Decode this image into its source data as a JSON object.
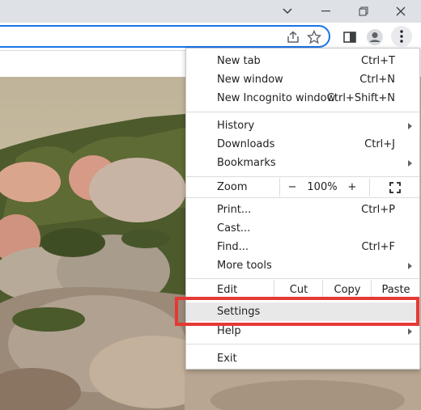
{
  "menu": {
    "new_tab": {
      "label": "New tab",
      "shortcut": "Ctrl+T"
    },
    "new_window": {
      "label": "New window",
      "shortcut": "Ctrl+N"
    },
    "new_incognito": {
      "label": "New Incognito window",
      "shortcut": "Ctrl+Shift+N"
    },
    "history": {
      "label": "History"
    },
    "downloads": {
      "label": "Downloads",
      "shortcut": "Ctrl+J"
    },
    "bookmarks": {
      "label": "Bookmarks"
    },
    "zoom": {
      "label": "Zoom",
      "minus": "−",
      "value": "100%",
      "plus": "+"
    },
    "print": {
      "label": "Print...",
      "shortcut": "Ctrl+P"
    },
    "cast": {
      "label": "Cast..."
    },
    "find": {
      "label": "Find...",
      "shortcut": "Ctrl+F"
    },
    "more_tools": {
      "label": "More tools"
    },
    "edit": {
      "label": "Edit",
      "cut": "Cut",
      "copy": "Copy",
      "paste": "Paste"
    },
    "settings": {
      "label": "Settings"
    },
    "help": {
      "label": "Help"
    },
    "exit": {
      "label": "Exit"
    }
  },
  "colors": {
    "highlight": "#e53935",
    "accent": "#1a73e8"
  }
}
